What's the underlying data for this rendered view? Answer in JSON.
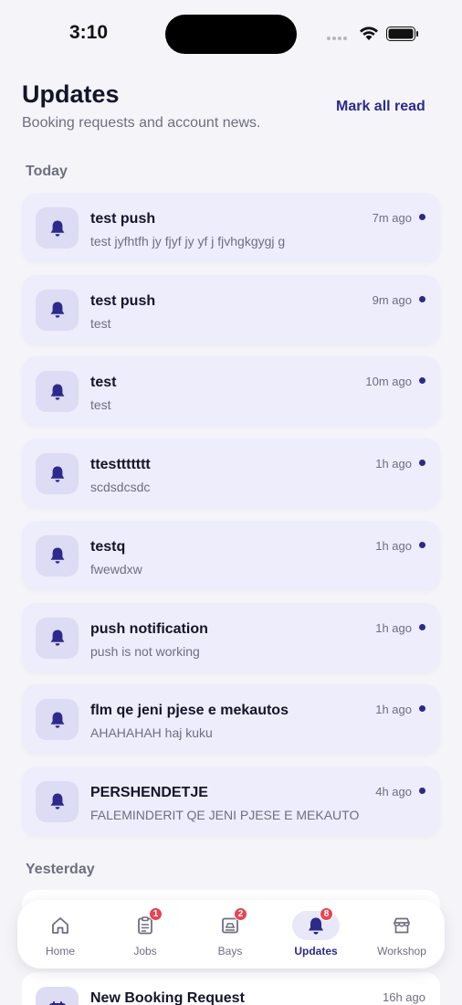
{
  "status_bar": {
    "time": "3:10"
  },
  "header": {
    "title": "Updates",
    "subtitle": "Booking requests and account news.",
    "mark_all_label": "Mark all read"
  },
  "sections": {
    "today": "Today",
    "yesterday": "Yesterday"
  },
  "notifications": [
    {
      "title": "test push",
      "body": "test jyfhtfh jy fjyf jy yf j fjvhgkgygj g",
      "time": "7m ago",
      "unread": true
    },
    {
      "title": "test push",
      "body": "test",
      "time": "9m ago",
      "unread": true
    },
    {
      "title": "test",
      "body": "test",
      "time": "10m ago",
      "unread": true
    },
    {
      "title": "ttesttttttt",
      "body": "scdsdcsdc",
      "time": "1h ago",
      "unread": true
    },
    {
      "title": "testq",
      "body": "fwewdxw",
      "time": "1h ago",
      "unread": true
    },
    {
      "title": "push notification",
      "body": "push is not working",
      "time": "1h ago",
      "unread": true
    },
    {
      "title": "flm qe jeni pjese e mekautos",
      "body": "AHAHAHAH haj kuku",
      "time": "1h ago",
      "unread": true
    },
    {
      "title": "PERSHENDETJE",
      "body": "FALEMINDERIT QE JENI PJESE E MEKAUTO",
      "time": "4h ago",
      "unread": true
    }
  ],
  "yesterday_notifications": [
    {
      "title": "New Booking Request",
      "time": "16h ago"
    }
  ],
  "tabs": [
    {
      "label": "Home",
      "icon": "home-icon",
      "badge": null,
      "active": false
    },
    {
      "label": "Jobs",
      "icon": "clipboard-icon",
      "badge": "1",
      "active": false
    },
    {
      "label": "Bays",
      "icon": "bay-icon",
      "badge": "2",
      "active": false
    },
    {
      "label": "Updates",
      "icon": "bell-icon",
      "badge": "8",
      "active": true
    },
    {
      "label": "Workshop",
      "icon": "store-icon",
      "badge": null,
      "active": false
    }
  ],
  "colors": {
    "accent": "#2d2a8c",
    "card_bg": "#ededfb",
    "badge": "#e64553",
    "background": "#f5f5f9"
  }
}
